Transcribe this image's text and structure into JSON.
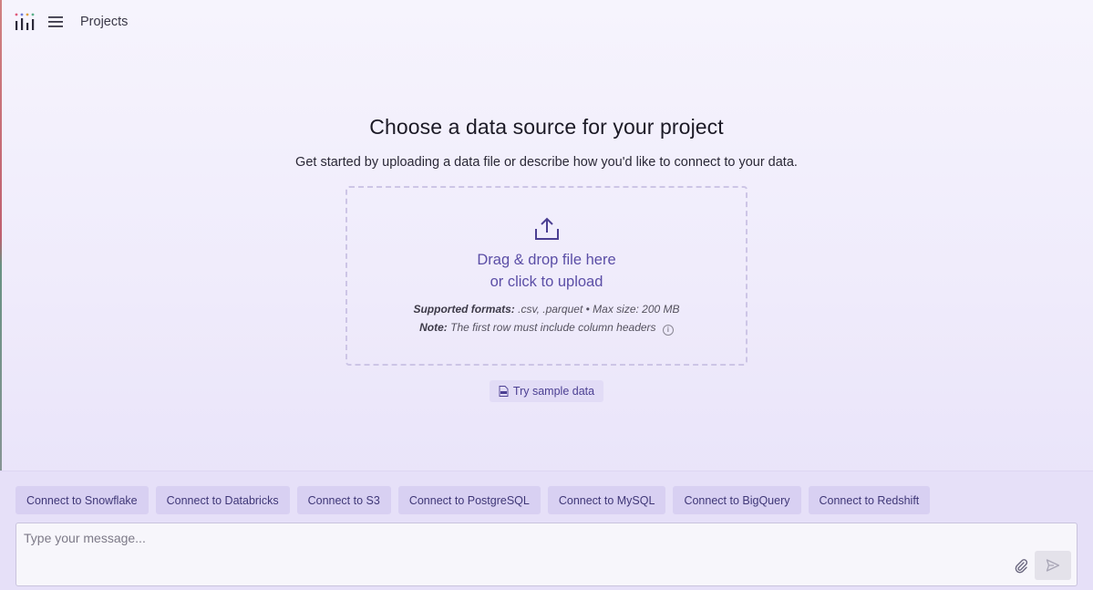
{
  "header": {
    "breadcrumb": "Projects",
    "logo_icon": "bar-chart-logo-icon",
    "menu_icon": "hamburger-icon"
  },
  "main": {
    "title": "Choose a data source for your project",
    "subtitle": "Get started by uploading a data file or describe how you'd like to connect to your data.",
    "dropzone": {
      "icon": "upload-icon",
      "line1": "Drag & drop file here",
      "line2": "or click to upload",
      "formats_label": "Supported formats:",
      "formats_value": ".csv, .parquet • Max size: 200 MB",
      "note_label": "Note:",
      "note_value": "The first row must include column headers",
      "info_icon": "info-icon"
    },
    "sample_button": {
      "label": "Try sample data",
      "icon": "csv-file-icon"
    }
  },
  "footer": {
    "chips": [
      "Connect to Snowflake",
      "Connect to Databricks",
      "Connect to S3",
      "Connect to PostgreSQL",
      "Connect to MySQL",
      "Connect to BigQuery",
      "Connect to Redshift"
    ],
    "message_placeholder": "Type your message...",
    "attach_icon": "paperclip-icon",
    "send_icon": "send-icon"
  },
  "colors": {
    "accent": "#5b4ea6",
    "chip_bg": "#d8d0f2",
    "background": "#efebfb"
  }
}
